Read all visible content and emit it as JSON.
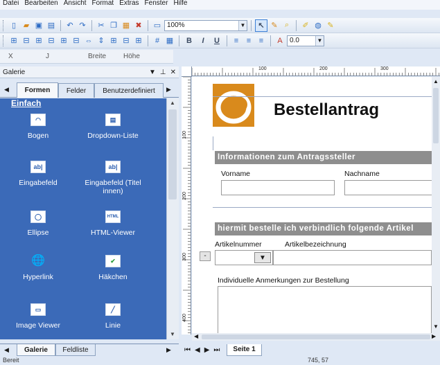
{
  "menu": [
    "Datei",
    "Bearbeiten",
    "Ansicht",
    "Format",
    "Extras",
    "Fenster",
    "Hilfe"
  ],
  "toolbar1": {
    "zoom": "100%"
  },
  "toolbar2": {
    "line_width": "0.0",
    "bold": "B",
    "italic": "I",
    "underline": "U"
  },
  "coords": {
    "x": "X",
    "y": "J",
    "width": "Breite",
    "height": "Höhe"
  },
  "gallery": {
    "title": "Galerie",
    "tabs": [
      "Formen",
      "Felder",
      "Benutzerdefiniert"
    ],
    "section": "Einfach",
    "items": [
      {
        "label": "Bogen",
        "icon": "arc-icon"
      },
      {
        "label": "Dropdown-Liste",
        "icon": "dropdown-icon"
      },
      {
        "label": "Eingabefeld",
        "icon": "textfield-icon",
        "glyph": "ab|"
      },
      {
        "label": "Eingabefeld (Titel innen)",
        "icon": "textfield-titled-icon",
        "glyph": "ab|"
      },
      {
        "label": "Ellipse",
        "icon": "ellipse-icon"
      },
      {
        "label": "HTML-Viewer",
        "icon": "html-icon",
        "glyph": "HTML"
      },
      {
        "label": "Hyperlink",
        "icon": "hyperlink-icon"
      },
      {
        "label": "Häkchen",
        "icon": "checkmark-icon",
        "glyph": "✔"
      },
      {
        "label": "Image Viewer",
        "icon": "image-viewer-icon"
      },
      {
        "label": "Linie",
        "icon": "line-icon"
      }
    ],
    "bottom_tabs": [
      "Galerie",
      "Feldliste"
    ]
  },
  "ruler": {
    "h": [
      "100",
      "200",
      "300"
    ],
    "v": [
      "100",
      "200",
      "300",
      "400"
    ]
  },
  "doc": {
    "title": "Bestellantrag",
    "section1": "Informationen zum Antragssteller",
    "vorname": "Vorname",
    "nachname": "Nachname",
    "section2": "hiermit bestelle ich verbindlich folgende Artikel",
    "artikelnummer": "Artikelnummer",
    "artikelbezeichnung": "Artikelbezeichnung",
    "remove": "-",
    "anmerkungen": "Individuelle Anmerkungen zur Bestellung"
  },
  "sheet_tab": "Seite 1",
  "status": {
    "text": "Bereit",
    "coords": "745, 57"
  },
  "colors": {
    "gallery_bg": "#3b6ab8",
    "logo": "#d98a1c",
    "band": "#8e8e8e"
  }
}
